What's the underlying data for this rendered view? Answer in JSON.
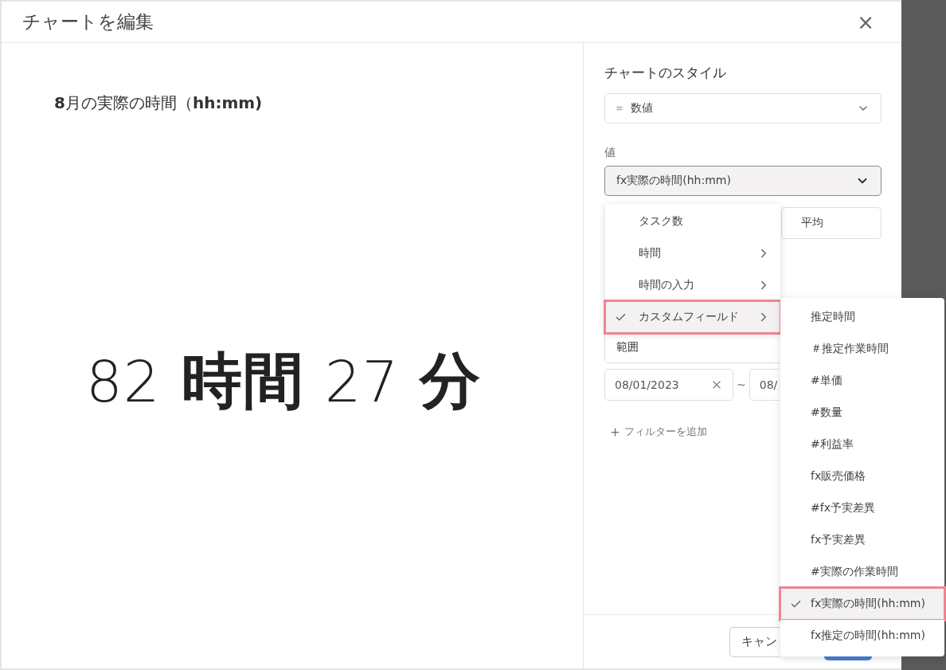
{
  "dialog": {
    "title": "チャートを編集",
    "close": "×"
  },
  "preview": {
    "title": "**8**月の実際の時間（**hh:mm)**",
    "value_parts": [
      {
        "text": "82",
        "kind": "number"
      },
      {
        "text": "時間",
        "kind": "unit"
      },
      {
        "text": "27",
        "kind": "number"
      },
      {
        "text": "分",
        "kind": "unit"
      }
    ]
  },
  "settings": {
    "style_label": "チャートのスタイル",
    "style_icon": "⌗",
    "style_value": "数値",
    "value_label": "値",
    "value_select": "fx実際の時間(hh:mm)",
    "aggregate": "平均",
    "range": "範囲",
    "date_from": "08/01/2023",
    "date_separator": "~",
    "date_to": "08/",
    "add_filter": "フィルターを追加"
  },
  "footer": {
    "cancel": "キャン"
  },
  "menu": [
    {
      "label": "タスク数",
      "submenu": false,
      "selected": false
    },
    {
      "label": "時間",
      "submenu": true,
      "selected": false
    },
    {
      "label": "時間の入力",
      "submenu": true,
      "selected": false
    },
    {
      "label": "カスタムフィールド",
      "submenu": true,
      "selected": true
    }
  ],
  "submenu": [
    {
      "label": "推定時間",
      "selected": false
    },
    {
      "label": "＃推定作業時間",
      "selected": false
    },
    {
      "label": "#単価",
      "selected": false
    },
    {
      "label": "#数量",
      "selected": false
    },
    {
      "label": "#利益率",
      "selected": false
    },
    {
      "label": "fx販売価格",
      "selected": false
    },
    {
      "label": "#fx予実差異",
      "selected": false
    },
    {
      "label": "fx予実差異",
      "selected": false
    },
    {
      "label": "#実際の作業時間",
      "selected": false
    },
    {
      "label": "fx実際の時間(hh:mm)",
      "selected": true
    },
    {
      "label": "fx推定の時間(hh:mm)",
      "selected": false
    }
  ]
}
